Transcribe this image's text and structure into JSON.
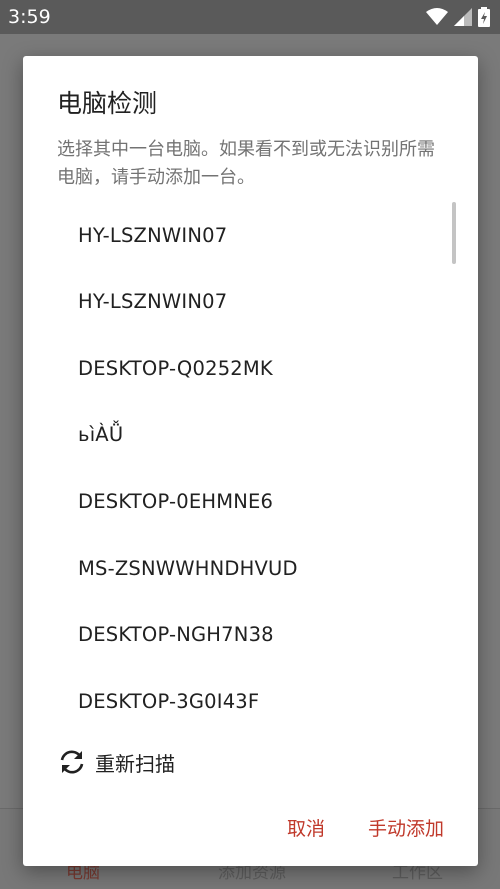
{
  "status_bar": {
    "time": "3:59"
  },
  "background_app": {
    "nav": [
      "电脑",
      "添加资源",
      "工作区"
    ]
  },
  "dialog": {
    "title": "电脑检测",
    "message": "选择其中一台电脑。如果看不到或无法识别所需电脑，请手动添加一台。",
    "computers": [
      "HY-LSZNWIN07",
      "HY-LSZNWIN07",
      "DESKTOP-Q0252MK",
      "ьìÀǙ",
      "DESKTOP-0EHMNE6",
      "MS-ZSNWWHNDHVUD",
      "DESKTOP-NGH7N38",
      "DESKTOP-3G0I43F"
    ],
    "rescan_label": "重新扫描",
    "cancel_label": "取消",
    "add_manually_label": "手动添加"
  },
  "colors": {
    "accent": "#c0392b",
    "scrim": "#6f6f6f"
  }
}
